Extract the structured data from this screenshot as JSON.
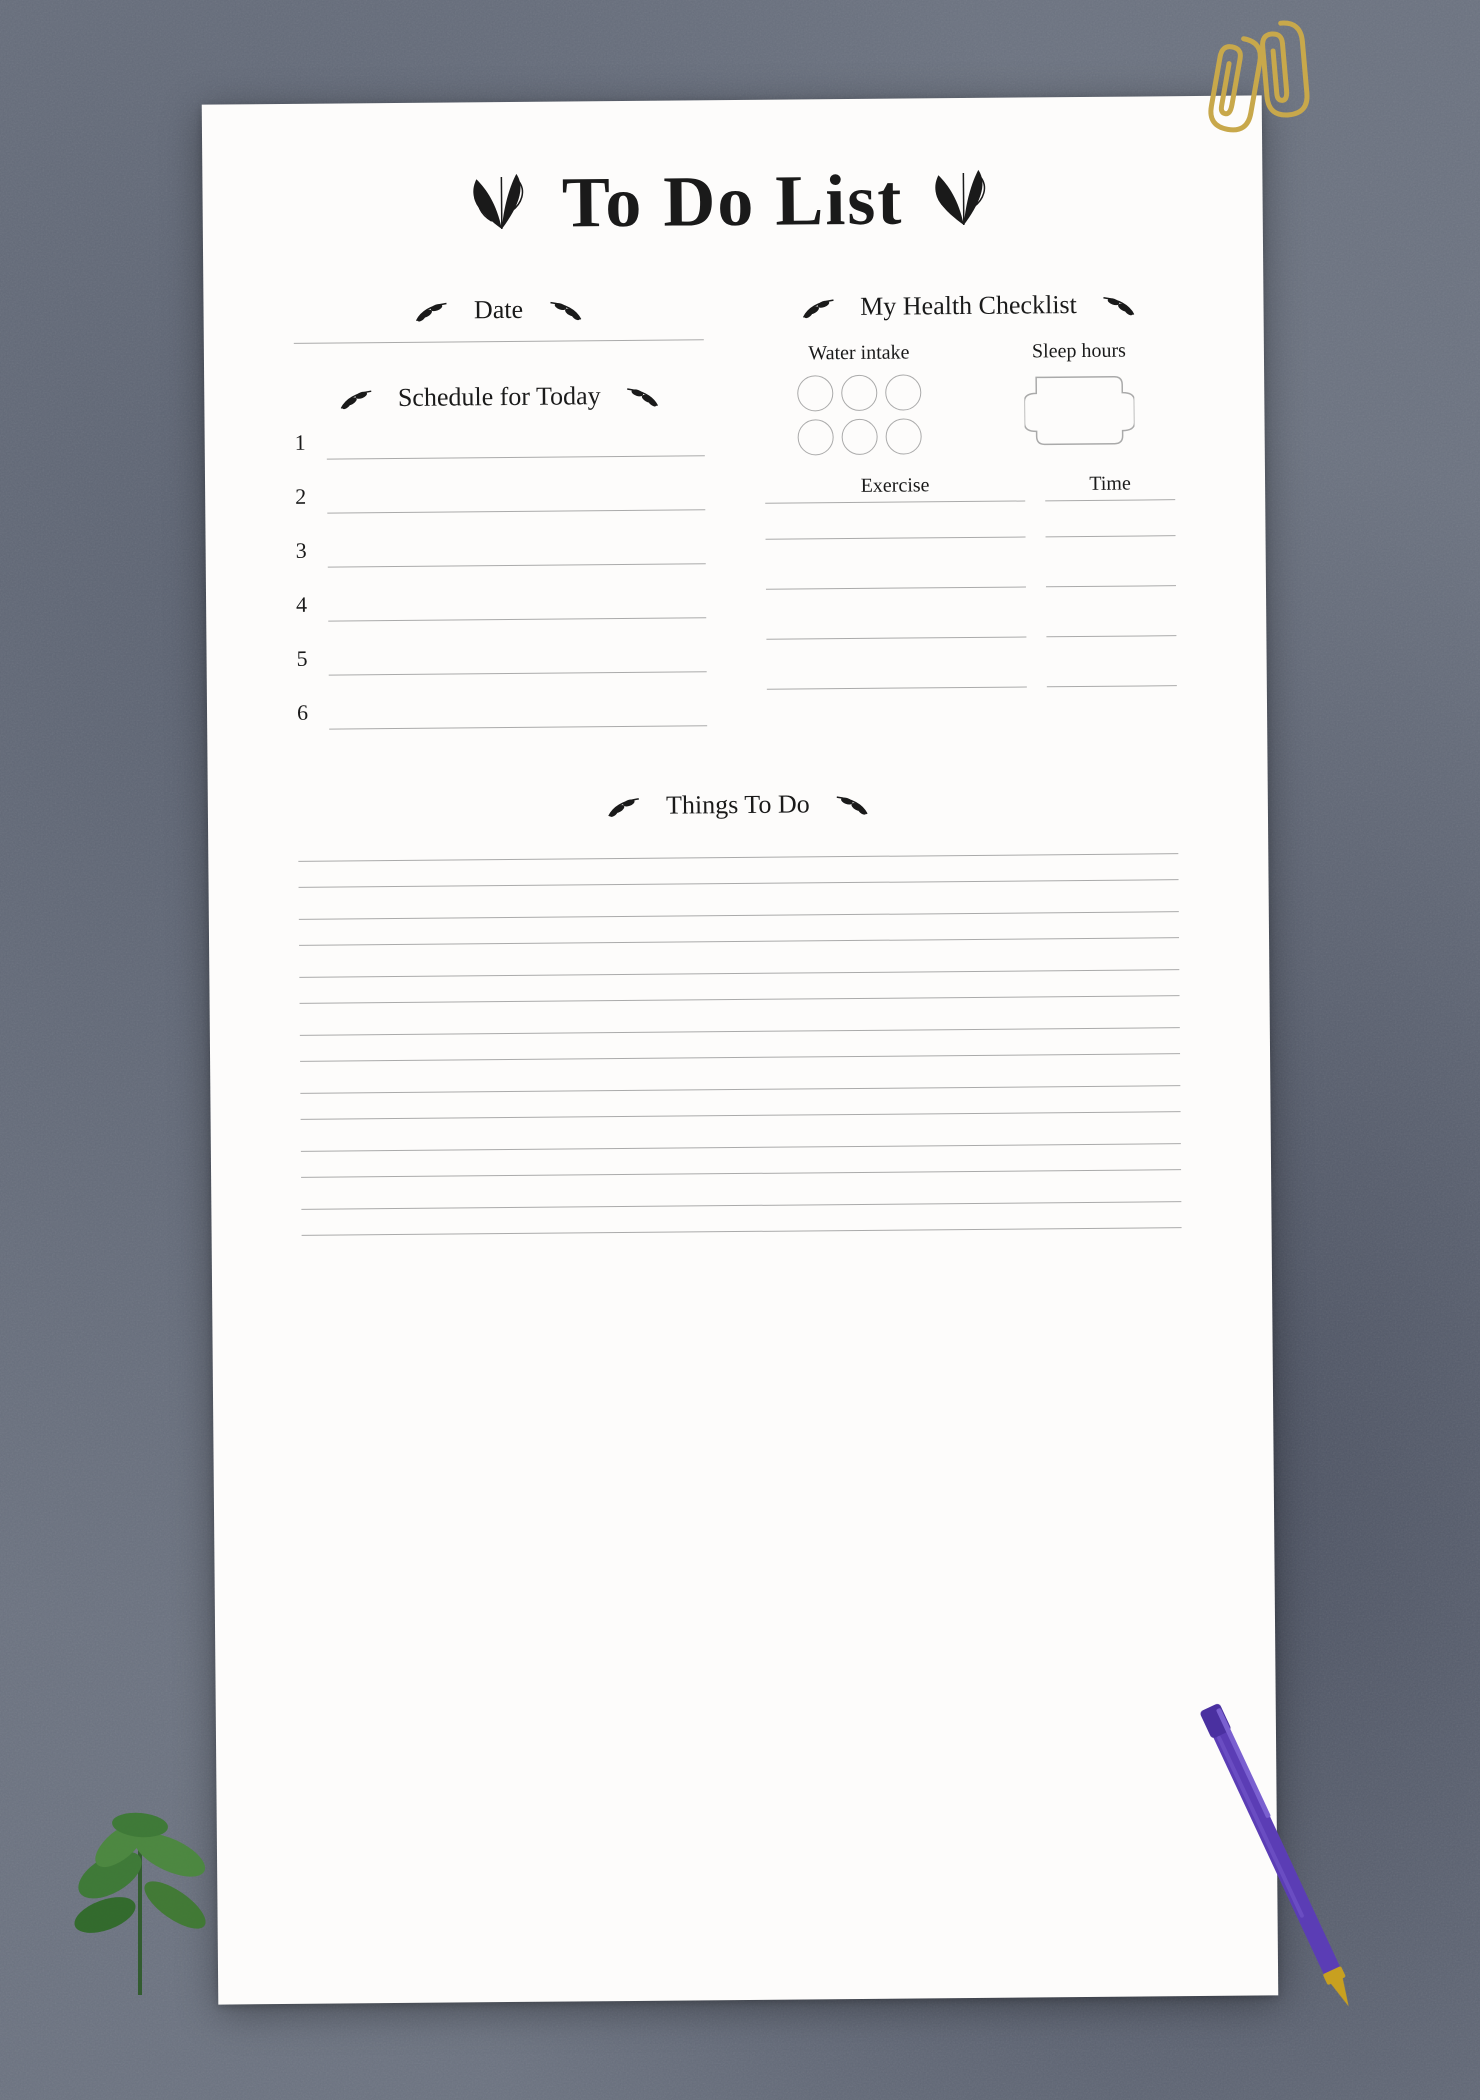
{
  "page": {
    "title": "To Do List",
    "background_color": "#6b7280",
    "paper_color": "#fdfcfb"
  },
  "sections": {
    "date": {
      "label": "Date"
    },
    "schedule": {
      "label": "Schedule for Today",
      "items": [
        "1",
        "2",
        "3",
        "4",
        "5",
        "6"
      ]
    },
    "health": {
      "label": "My Health Checklist",
      "water_label": "Water intake",
      "sleep_label": "Sleep hours",
      "exercise_label": "Exercise",
      "time_label": "Time",
      "water_circles": 6,
      "exercise_rows": 4
    },
    "things": {
      "label": "Things To Do",
      "line_count": 14
    }
  },
  "decorations": {
    "branch_left": "🌿",
    "branch_right": "🌿"
  }
}
